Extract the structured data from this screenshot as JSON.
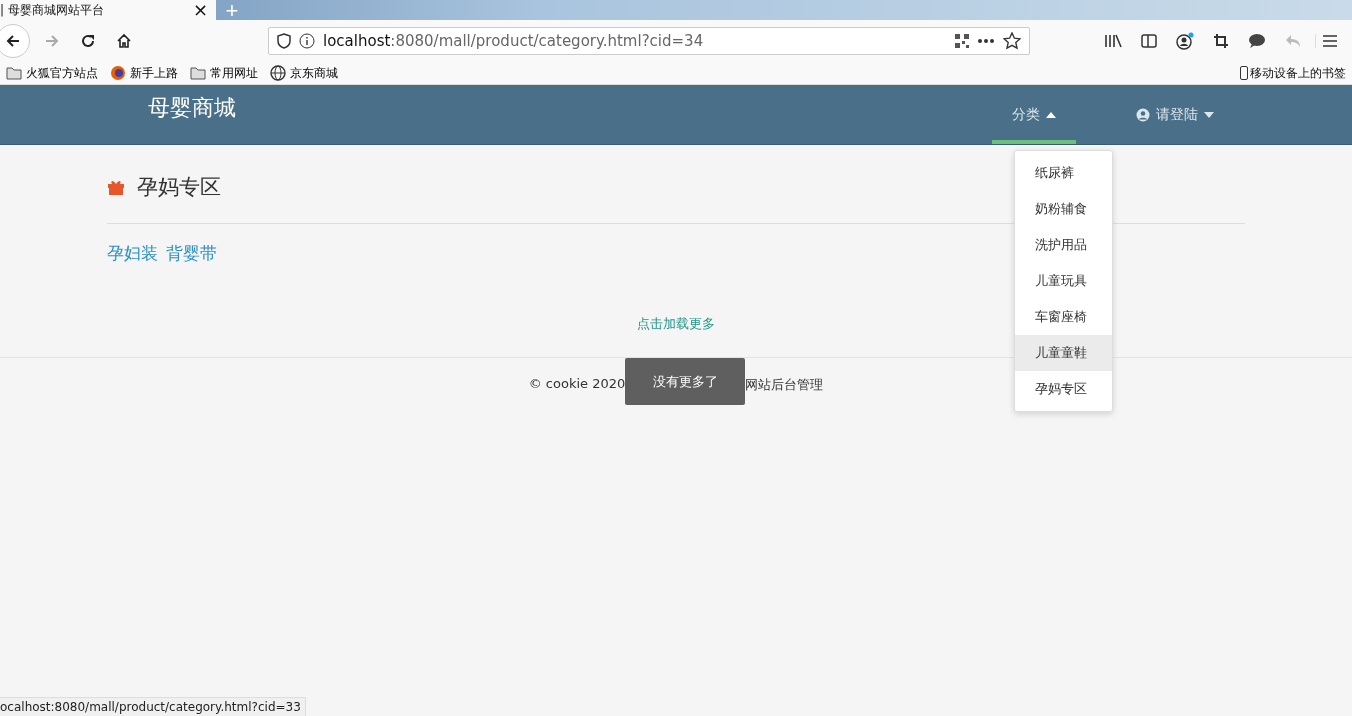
{
  "browser": {
    "tab_title": "| 母婴商城网站平台",
    "tab_close": "×",
    "new_tab": "+",
    "url_host": "localhost",
    "url_rest": ":8080/mall/product/category.html?cid=34",
    "bookmarks": [
      {
        "label": "火狐官方站点",
        "kind": "folder"
      },
      {
        "label": "新手上路",
        "kind": "fox"
      },
      {
        "label": "常用网址",
        "kind": "folder"
      },
      {
        "label": "京东商城",
        "kind": "globe"
      }
    ],
    "mobile_bookmarks": "移动设备上的书签"
  },
  "header": {
    "logo": "母婴商城",
    "nav": [
      {
        "label": "分类",
        "selected": true,
        "expanded": true,
        "kind": "menu"
      },
      {
        "label": "请登陆",
        "selected": false,
        "expanded": false,
        "kind": "user"
      }
    ]
  },
  "dropdown": [
    {
      "label": "纸尿裤",
      "hovered": false
    },
    {
      "label": "奶粉辅食",
      "hovered": false
    },
    {
      "label": "洗护用品",
      "hovered": false
    },
    {
      "label": "儿童玩具",
      "hovered": false
    },
    {
      "label": "车窗座椅",
      "hovered": false
    },
    {
      "label": "儿童童鞋",
      "hovered": true
    },
    {
      "label": "孕妈专区",
      "hovered": false
    }
  ],
  "section": {
    "title": "孕妈专区",
    "subcategories": [
      "孕妇装",
      "背婴带"
    ],
    "load_more": "点击加载更多"
  },
  "footer": {
    "left": "© cookie 2020",
    "right": "网站后台管理"
  },
  "toast": "没有更多了",
  "status_bar": "ocalhost:8080/mall/product/category.html?cid=33"
}
